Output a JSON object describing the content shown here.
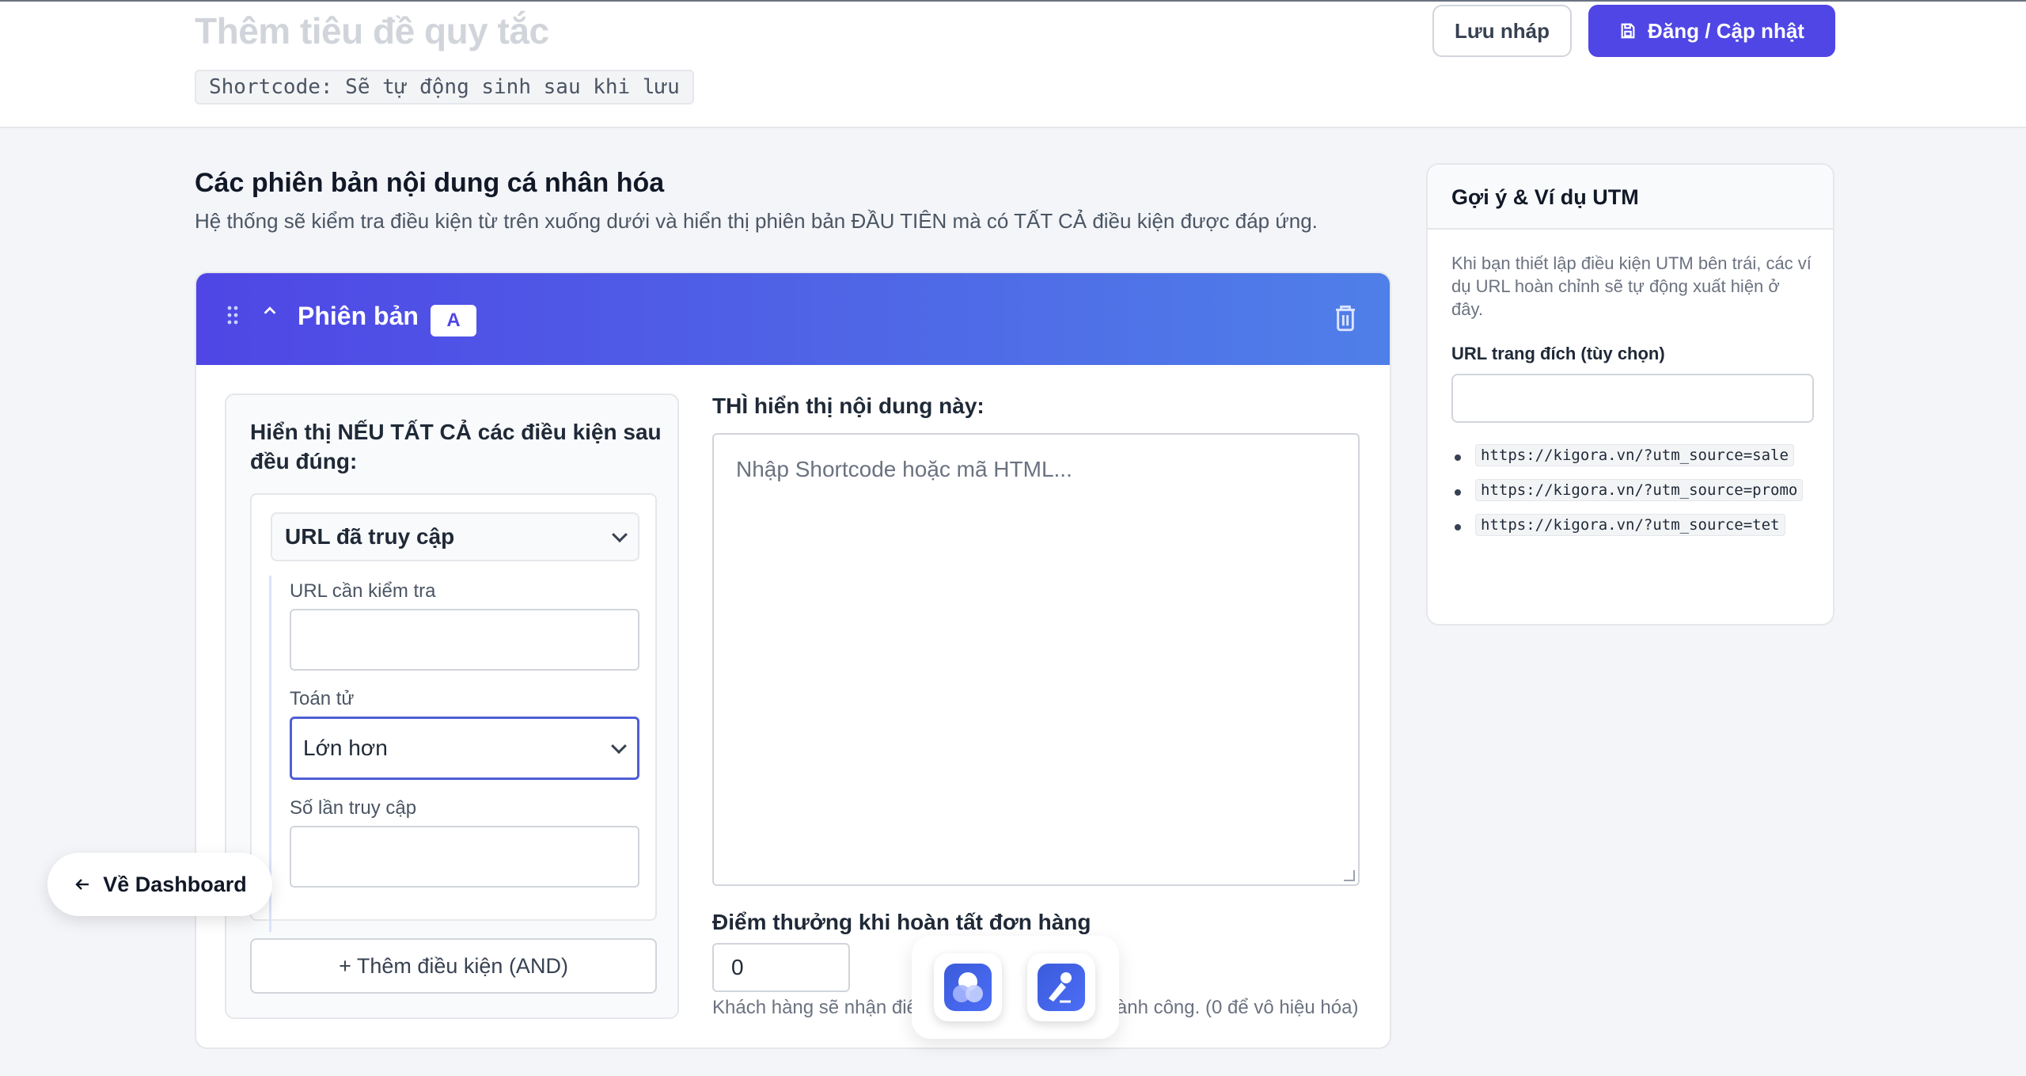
{
  "header": {
    "rule_title_placeholder": "Thêm tiêu đề quy tắc",
    "shortcode_text": "Shortcode: Sẽ tự động sinh sau khi lưu",
    "draft_label": "Lưu nháp",
    "publish_label": "Đăng / Cập nhật"
  },
  "main": {
    "title": "Các phiên bản nội dung cá nhân hóa",
    "description": "Hệ thống sẽ kiểm tra điều kiện từ trên xuống dưới và hiển thị phiên bản ĐẦU TIÊN mà có TẤT CẢ điều kiện được đáp ứng."
  },
  "version": {
    "label": "Phiên bản",
    "badge": "A",
    "conditions_title": "Hiển thị NẾU TẤT CẢ các điều kiện sau đều đúng:",
    "condition_type": "URL đã truy cập",
    "url_check_label": "URL cần kiểm tra",
    "url_check_value": "",
    "operator_label": "Toán tử",
    "operator_value": "Lớn hơn",
    "visits_label": "Số lần truy cập",
    "visits_value": "",
    "add_condition_label": "+ Thêm điều kiện (AND)",
    "then_label": "THÌ hiển thị nội dung này:",
    "content_placeholder": "Nhập Shortcode hoặc mã HTML...",
    "points_label": "Điểm thưởng khi hoàn tất đơn hàng",
    "points_value": "0",
    "points_help_start": "Khách hàng sẽ nhận điểm",
    "points_help_end": "ành công. (0 để vô hiệu hóa)"
  },
  "sidebar": {
    "title": "Gợi ý & Ví dụ UTM",
    "description": "Khi bạn thiết lập điều kiện UTM bên trái, các ví dụ URL hoàn chỉnh sẽ tự động xuất hiện ở đây.",
    "landing_label": "URL trang đích (tùy chọn)",
    "landing_value": "",
    "examples": [
      "https://kigora.vn/?utm_source=sale",
      "https://kigora.vn/?utm_source=promo",
      "https://kigora.vn/?utm_source=tet"
    ]
  },
  "back_button_label": "Về Dashboard",
  "icons": {
    "publish": "save-icon",
    "drag": "drag-handle-icon",
    "collapse": "chevron-up-icon",
    "delete": "trash-icon",
    "back": "arrow-left-icon"
  },
  "colors": {
    "primary": "#4f46e5",
    "header_gradient_end": "#4f7fe8"
  }
}
